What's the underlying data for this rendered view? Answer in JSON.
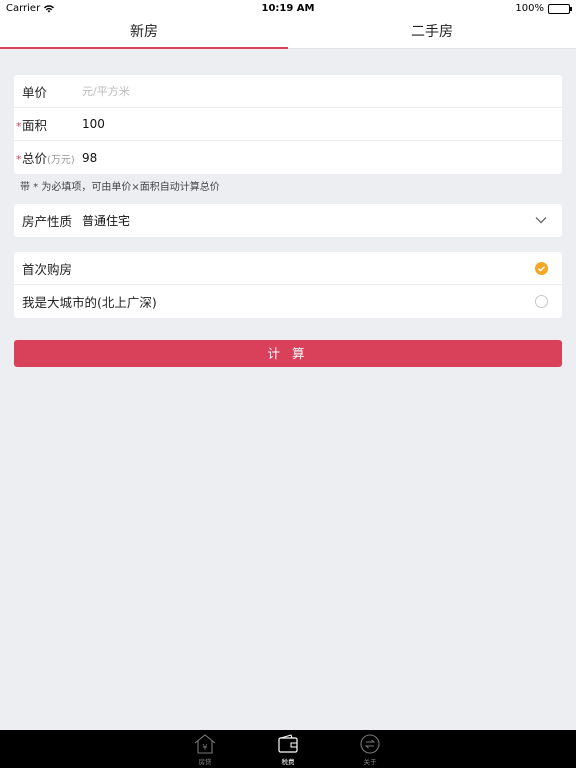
{
  "status_bar": {
    "carrier": "Carrier",
    "time": "10:19 AM",
    "battery": "100%"
  },
  "tabs": [
    {
      "label": "新房",
      "active": true
    },
    {
      "label": "二手房",
      "active": false
    }
  ],
  "form": {
    "unit_price": {
      "label": "单价",
      "placeholder": "元/平方米"
    },
    "area": {
      "required_mark": "*",
      "label": "面积",
      "value": "100"
    },
    "total_price": {
      "required_mark": "*",
      "label": "总价",
      "unit": "(万元)",
      "value": "98"
    },
    "hint": "带 * 为必填项，可由单价×面积自动计算总价"
  },
  "property_type": {
    "label": "房产性质",
    "value": "普通住宅",
    "icon": "chevron-down-icon"
  },
  "options": [
    {
      "label": "首次购房",
      "checked": true
    },
    {
      "label": "我是大城市的(北上广深)",
      "checked": false
    }
  ],
  "calculate_button": {
    "label": "计 算"
  },
  "tab_bar": [
    {
      "label": "房贷",
      "icon": "house-yen-icon",
      "active": false
    },
    {
      "label": "税费",
      "icon": "wallet-icon",
      "active": true
    },
    {
      "label": "关于",
      "icon": "info-circle-icon",
      "active": false
    }
  ],
  "colors": {
    "accent": "#d9405a",
    "check": "#f5a623",
    "background": "#eceef2"
  }
}
